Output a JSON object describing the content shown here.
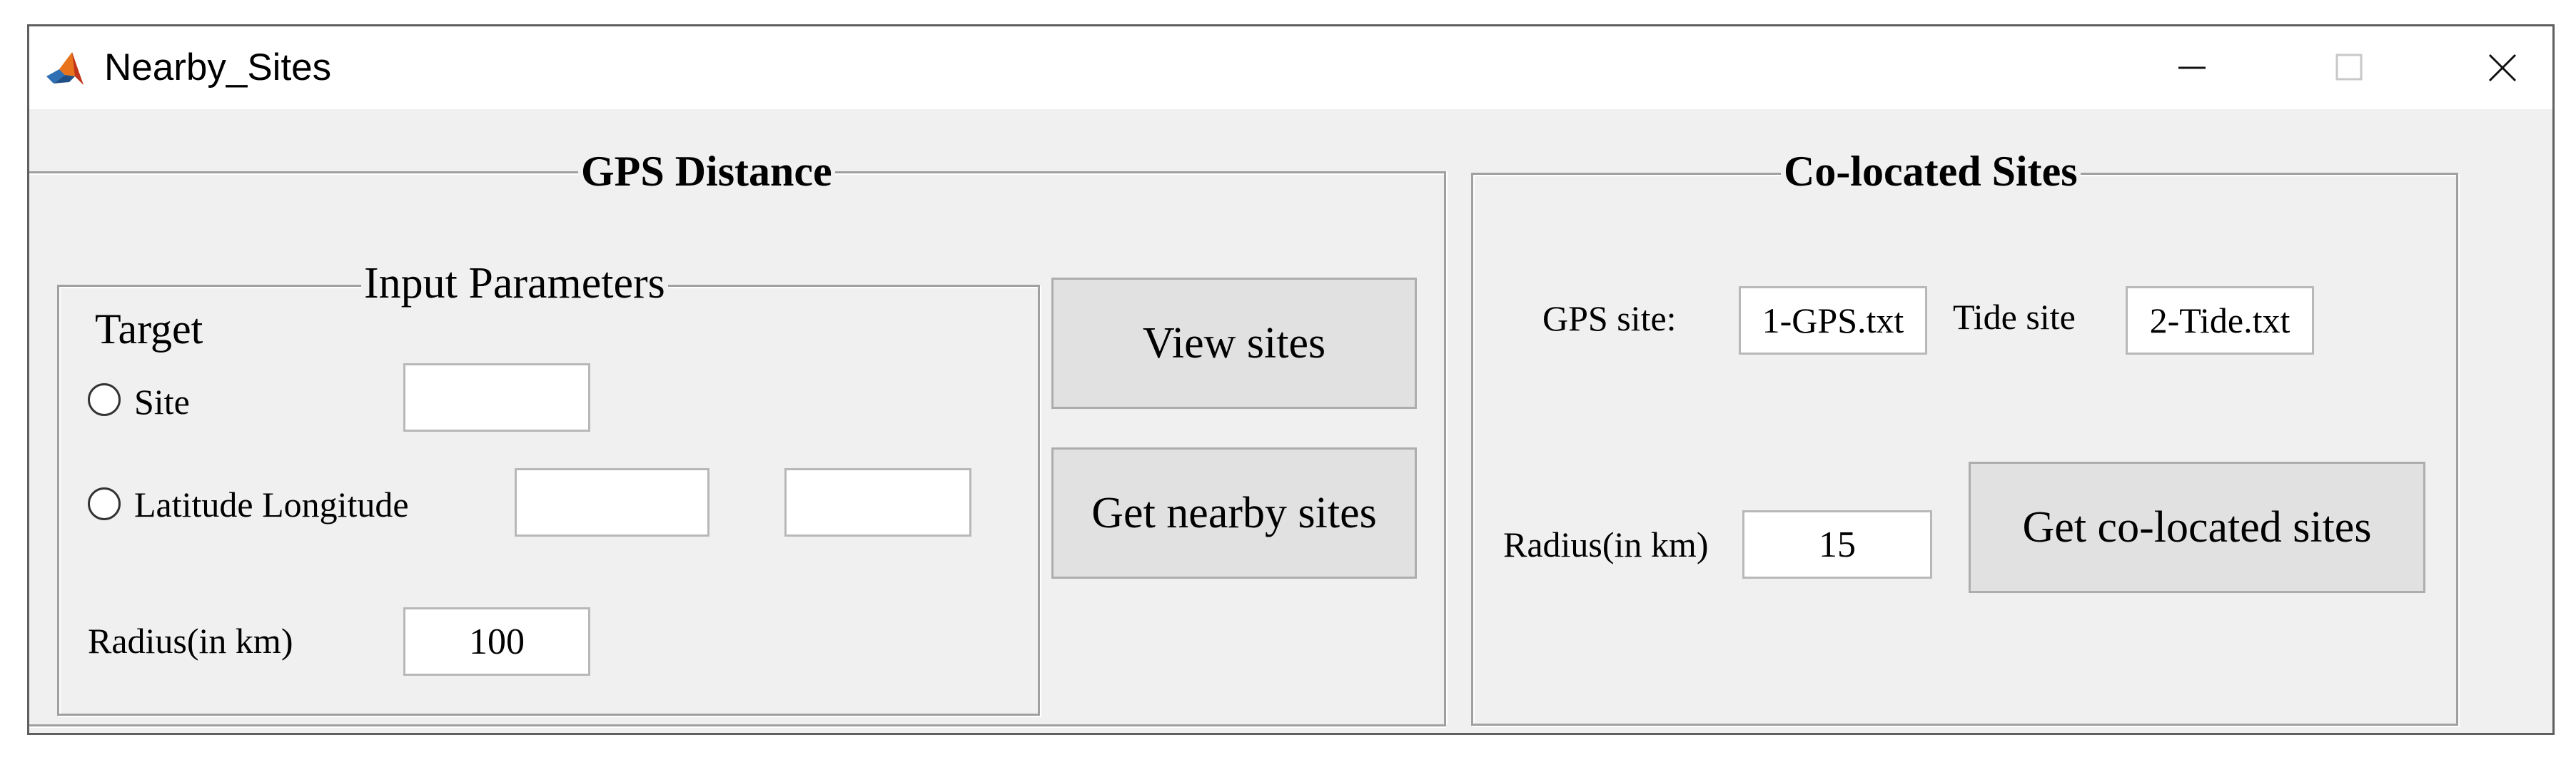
{
  "window": {
    "title": "Nearby_Sites",
    "controls": {
      "minimize_icon": "minimize-icon",
      "maximize_icon": "maximize-icon",
      "close_icon": "close-icon"
    }
  },
  "gps_distance": {
    "title": "GPS Distance",
    "input_parameters": {
      "title": "Input Parameters",
      "target_label": "Target",
      "site_option_label": "Site",
      "site_value": "",
      "latlon_option_label": "Latitude Longitude",
      "latitude_value": "",
      "longitude_value": "",
      "radius_label": "Radius(in km)",
      "radius_value": "100"
    },
    "view_sites_label": "View sites",
    "get_nearby_sites_label": "Get nearby sites"
  },
  "colocated": {
    "title": "Co-located Sites",
    "gps_site_label": "GPS site:",
    "gps_site_value": "1-GPS.txt",
    "tide_site_label": "Tide site",
    "tide_site_value": "2-Tide.txt",
    "radius_label": "Radius(in km)",
    "radius_value": "15",
    "get_colocated_label": "Get co-located sites"
  }
}
